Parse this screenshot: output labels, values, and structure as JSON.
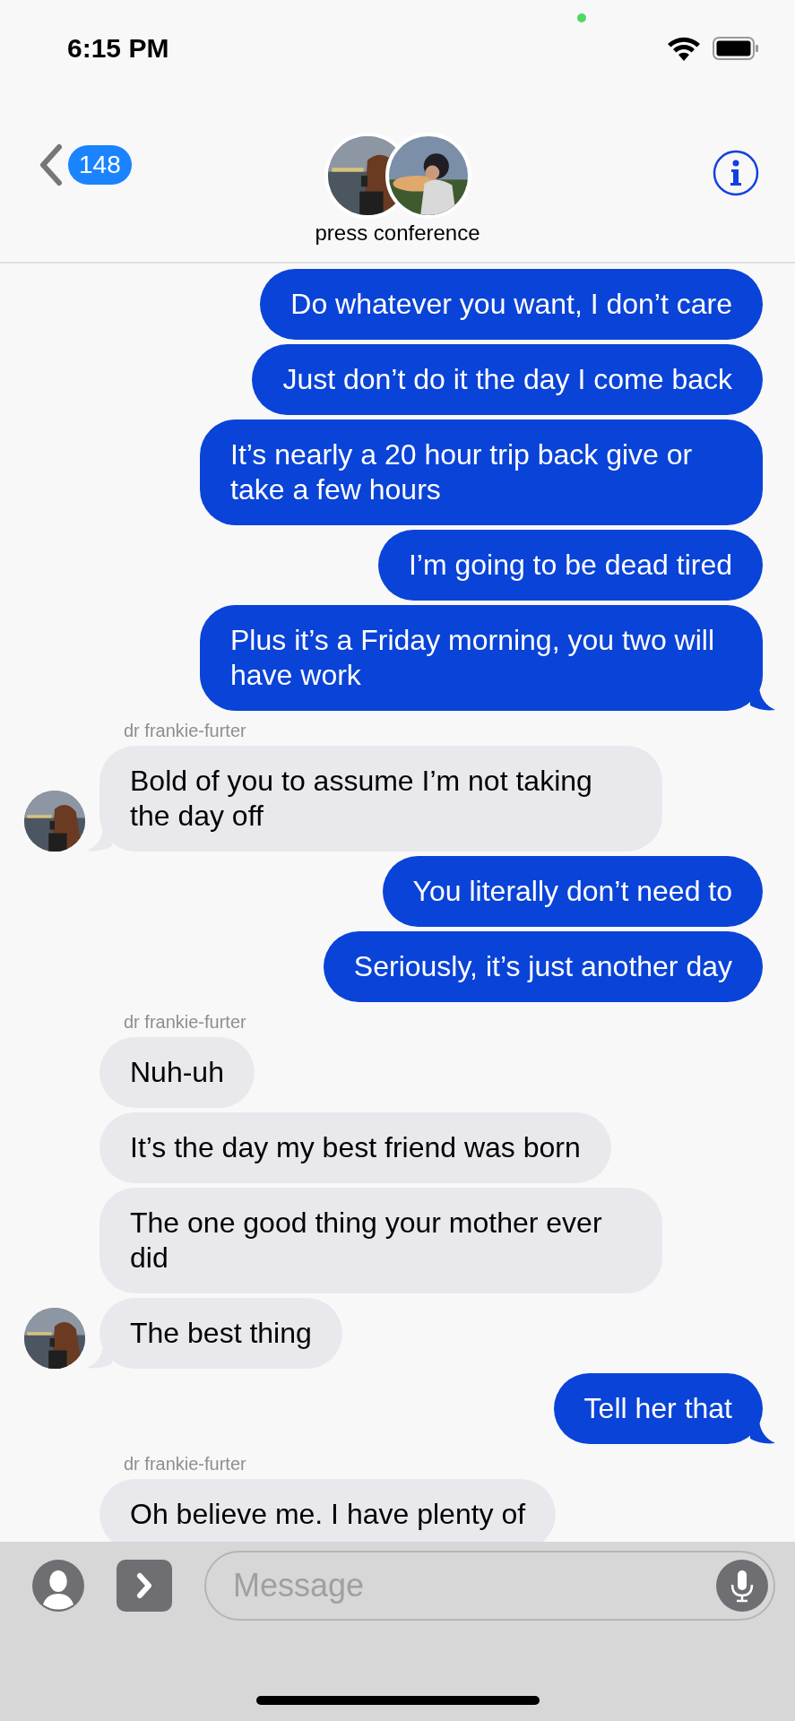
{
  "status_bar": {
    "time": "6:15 PM"
  },
  "header": {
    "unread_count": "148",
    "title": "press conference"
  },
  "messages": [
    {
      "kind": "sent",
      "text": "Do whatever you want, I don’t care",
      "tail": false
    },
    {
      "kind": "sent",
      "text": "Just don’t do it the day I come back",
      "tail": false
    },
    {
      "kind": "sent",
      "text": "It’s nearly a 20 hour trip back give or take a few hours",
      "tail": false
    },
    {
      "kind": "sent",
      "text": "I’m going to be dead tired",
      "tail": false
    },
    {
      "kind": "sent",
      "text": "Plus it’s a Friday morning, you two will have work",
      "tail": true
    },
    {
      "kind": "sender",
      "text": "dr frankie-furter"
    },
    {
      "kind": "received",
      "text": "Bold of you to assume I’m not taking the day off",
      "tail": true
    },
    {
      "kind": "sent",
      "text": "You literally don’t need to",
      "tail": false
    },
    {
      "kind": "sent",
      "text": "Seriously, it’s just another day",
      "tail": false
    },
    {
      "kind": "sender",
      "text": "dr frankie-furter"
    },
    {
      "kind": "received",
      "text": "Nuh-uh",
      "tail": false
    },
    {
      "kind": "received",
      "text": "It’s the day my best friend was born",
      "tail": false
    },
    {
      "kind": "received",
      "text": "The one good thing your mother ever did",
      "tail": false
    },
    {
      "kind": "received",
      "text": "The best thing",
      "tail": true
    },
    {
      "kind": "sent",
      "text": "Tell her that",
      "tail": true
    },
    {
      "kind": "sender",
      "text": "dr frankie-furter"
    },
    {
      "kind": "received",
      "text": "Oh believe me. I have plenty of",
      "tail": false
    }
  ],
  "composer": {
    "placeholder": "Message"
  }
}
